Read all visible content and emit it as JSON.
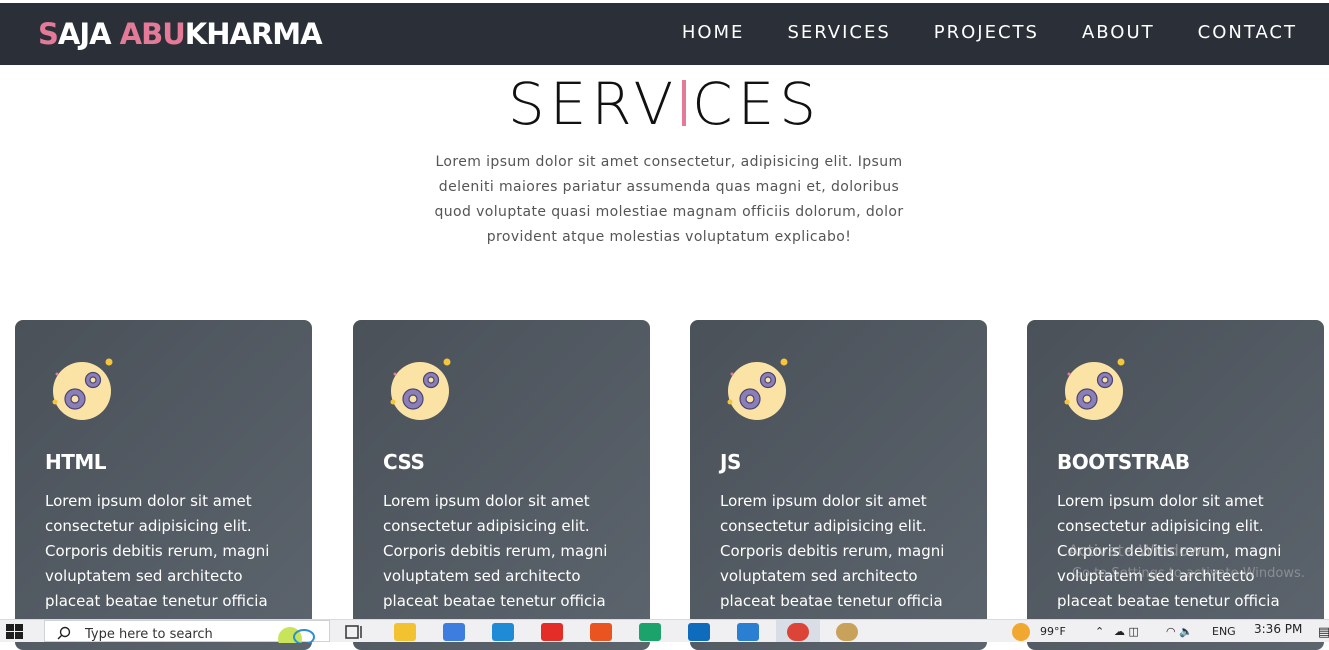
{
  "brand": {
    "part1_accent": "S",
    "part1_rest": "AJA ",
    "part2_accent": "ABU",
    "part2_rest": "KHARMA"
  },
  "nav": {
    "items": [
      {
        "label": "HOME"
      },
      {
        "label": "SERVICES"
      },
      {
        "label": "PROJECTS"
      },
      {
        "label": "ABOUT"
      },
      {
        "label": "CONTACT"
      }
    ]
  },
  "services": {
    "title_start": "SERV",
    "title_end": "CES",
    "intro": "Lorem ipsum dolor sit amet consectetur, adipisicing elit. Ipsum deleniti maiores pariatur assumenda quas magni et, doloribus quod voluptate quasi molestiae magnam officiis dolorum, dolor provident atque molestias voluptatum explicabo!",
    "cards": [
      {
        "title": "HTML",
        "text": "Lorem ipsum dolor sit amet consectetur adipisicing elit. Corporis debitis rerum, magni voluptatem sed architecto placeat beatae tenetur officia",
        "icon": "gears-icon"
      },
      {
        "title": "CSS",
        "text": "Lorem ipsum dolor sit amet consectetur adipisicing elit. Corporis debitis rerum, magni voluptatem sed architecto placeat beatae tenetur officia",
        "icon": "gears-icon"
      },
      {
        "title": "JS",
        "text": "Lorem ipsum dolor sit amet consectetur adipisicing elit. Corporis debitis rerum, magni voluptatem sed architecto placeat beatae tenetur officia",
        "icon": "gears-icon"
      },
      {
        "title": "BOOTSTRAB",
        "text": "Lorem ipsum dolor sit amet consectetur adipisicing elit. Corporis debitis rerum, magni voluptatem sed architecto placeat beatae tenetur officia",
        "icon": "gears-icon"
      }
    ]
  },
  "watermark": {
    "line1": "Activate Windows",
    "line2": "Go to Settings to activate Windows."
  },
  "taskbar": {
    "search_placeholder": "Type here to search",
    "weather": "99°F",
    "language": "ENG",
    "time": "3:36 PM"
  },
  "colors": {
    "navbar": "#2b3038",
    "accent": "#e37a98",
    "card": "#4f565e"
  }
}
